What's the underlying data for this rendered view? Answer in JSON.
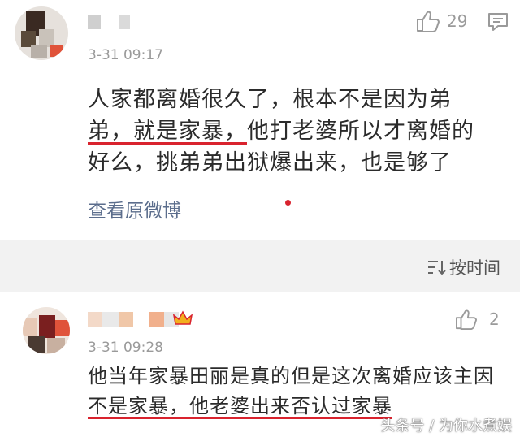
{
  "comments": [
    {
      "time": "3-31 09:17",
      "likes": "29",
      "lines": [
        {
          "parts": [
            {
              "text": "人家都离婚很久了，根本不是因为弟",
              "underline": false
            }
          ]
        },
        {
          "parts": [
            {
              "text": "弟，就是家暴，",
              "underline": true
            },
            {
              "text": "他打老婆所以才离婚的",
              "underline": false
            }
          ]
        },
        {
          "parts": [
            {
              "text": "好么，挑弟弟出狱爆出来，也是够了",
              "underline": false
            }
          ]
        }
      ],
      "view_original": "查看原微博"
    },
    {
      "time": "3-31 09:28",
      "likes": "2",
      "lines": [
        {
          "parts": [
            {
              "text": "他当年家暴田丽是真的但是这次离婚应该主因",
              "underline": false
            }
          ]
        },
        {
          "parts": [
            {
              "text": "不是家暴，他老婆出来否认过家暴",
              "underline": true
            }
          ]
        }
      ]
    }
  ],
  "sort": {
    "label": "按时间"
  },
  "watermark": "头条号 / 为你水煮娱",
  "colors": {
    "underline": "#d9232e",
    "link": "#5b6d8c",
    "divider_bg": "#f2f2f2"
  }
}
